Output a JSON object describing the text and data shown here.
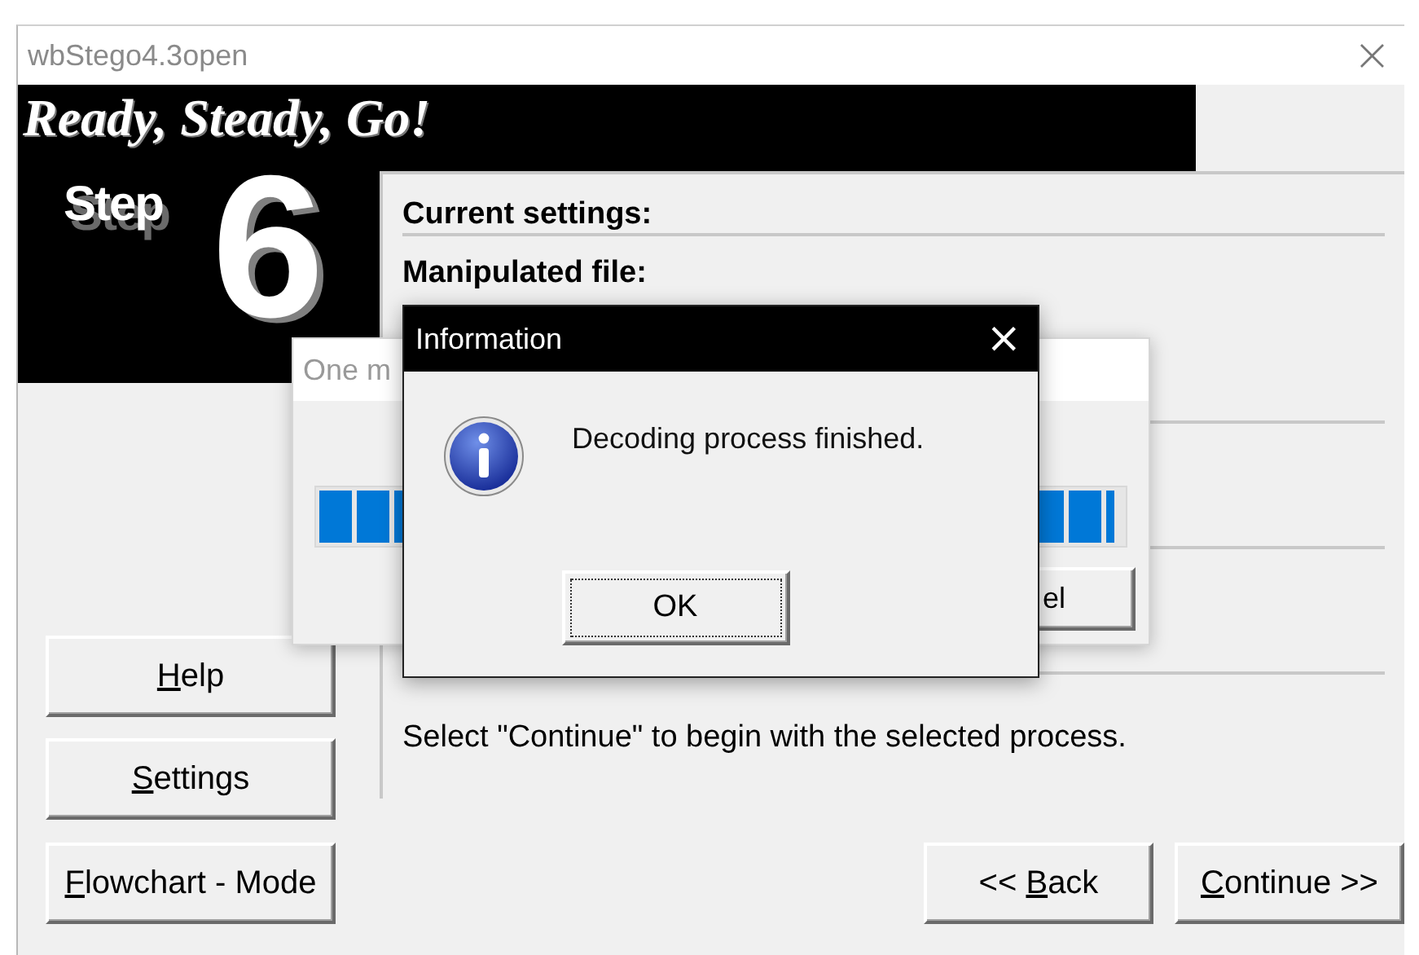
{
  "window": {
    "title": "wbStego4.3open",
    "close": "×"
  },
  "banner": {
    "heading": "Ready, Steady, Go!",
    "step_label": "Step",
    "step_number": "6"
  },
  "panel": {
    "sections": [
      "Current settings:",
      "Manipulated file:"
    ],
    "hint": "Select \"Continue\" to begin with the selected process."
  },
  "side_buttons": [
    {
      "key": "H",
      "after": "elp"
    },
    {
      "key": "S",
      "after": "ettings"
    },
    {
      "key": "F",
      "after": "lowchart - Mode"
    }
  ],
  "nav_buttons": [
    {
      "before": "<< ",
      "key": "B",
      "after": "ack"
    },
    {
      "key": "C",
      "after": "ontinue >>"
    }
  ],
  "progress_dialog": {
    "title": "One m",
    "level": 0.99,
    "button": "el"
  },
  "info_dialog": {
    "title": "Information",
    "close": "×",
    "message": "Decoding process finished.",
    "button": "OK"
  }
}
